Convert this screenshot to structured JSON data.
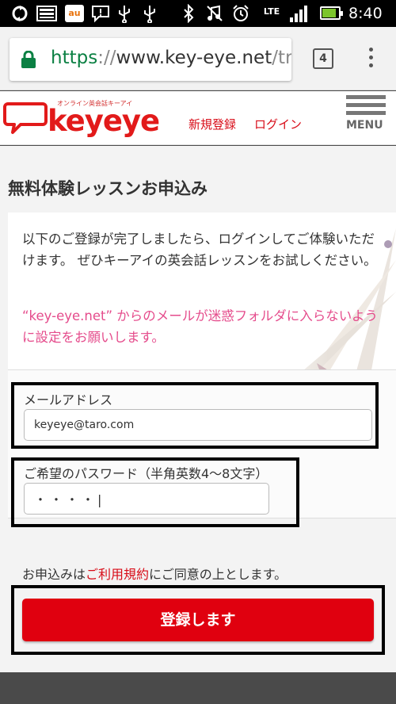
{
  "status_bar": {
    "icons": [
      "sync-icon",
      "image-icon",
      "au-icon",
      "message-icon",
      "usb-icon",
      "usb-icon",
      "bluetooth-icon",
      "mute-icon",
      "alarm-icon",
      "lte-signal-icon",
      "signal-icon",
      "battery-icon"
    ],
    "network": "LTE",
    "time": "8:40",
    "battery_level": 0.85
  },
  "browser": {
    "url_scheme": "https",
    "url_sep": "://",
    "url_host": "www.key-eye.net",
    "url_path": "/tri",
    "tab_count": "4",
    "secure_color": "#0b8043"
  },
  "header": {
    "logo_text": "keyeye",
    "logo_tagline": "オンライン英会話キーアイ",
    "signup_link": "新規登録",
    "login_link": "ログイン",
    "menu_label": "MENU"
  },
  "main": {
    "title": "無料体験レッスンお申込み",
    "intro": "以下のご登録が完了しましたら、ログインしてご体験いただけます。 ぜひキーアイの英会話レッスンをお試しください。",
    "notice": "“key-eye.net” からのメールが迷惑フォルダに入らないように設定をお願いします。",
    "email": {
      "label": "メールアドレス",
      "value": "keyeye@taro.com"
    },
    "password": {
      "label": "ご希望のパスワード（半角英数4〜8文字）",
      "value": "・・・・|"
    },
    "terms_prefix": "お申込みは",
    "terms_link": "ご利用規約",
    "terms_suffix": "にご同意の上とします。",
    "submit_label": "登録します"
  },
  "colors": {
    "brand_red": "#e0000f",
    "notice_pink": "#e54c8c",
    "link_red": "#d80c18"
  }
}
